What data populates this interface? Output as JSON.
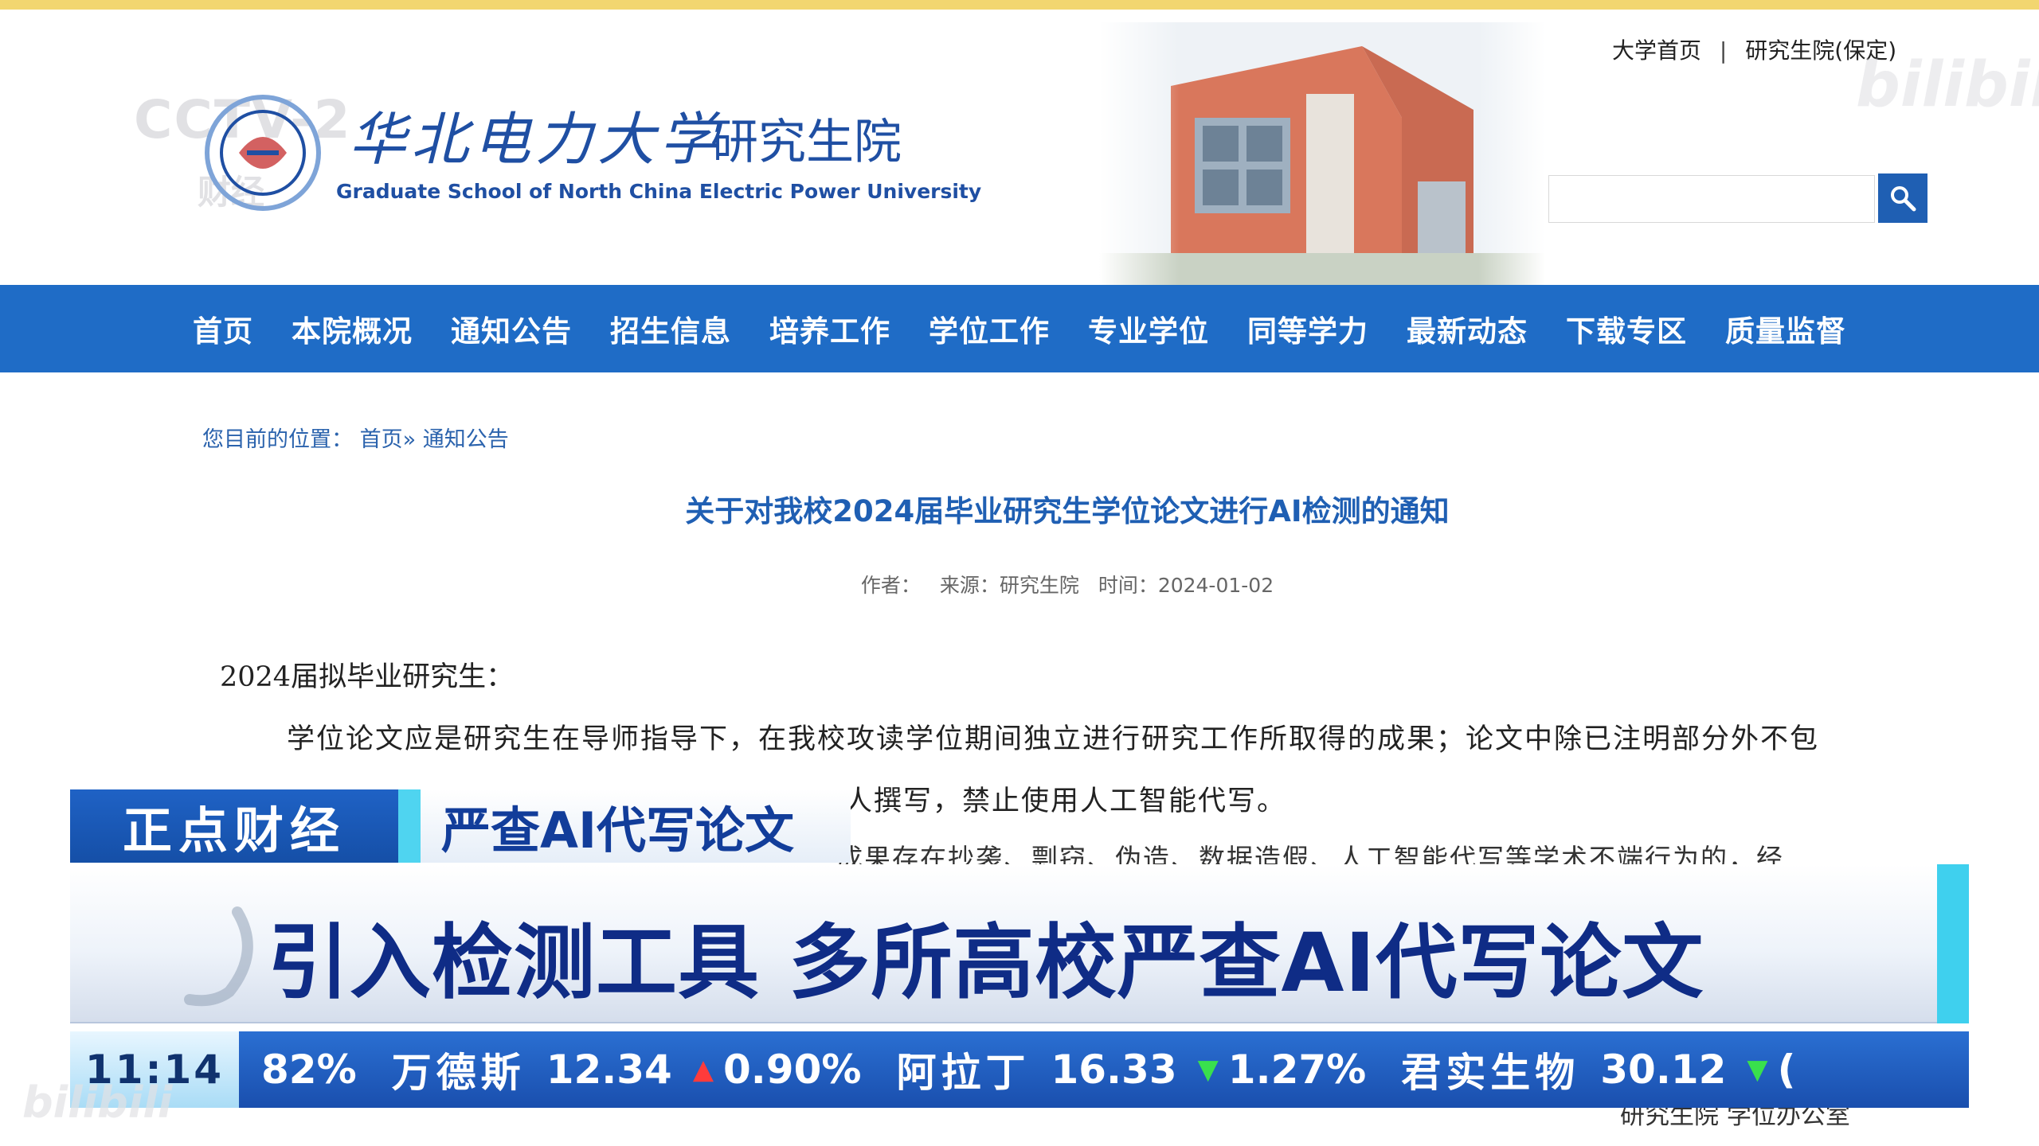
{
  "header": {
    "logo_cn": "华北电力大学",
    "logo_sub": "研究生院",
    "logo_en": "Graduate School of North China Electric  Power University",
    "top_link_1": "大学首页",
    "top_link_sep": "|",
    "top_link_2": "研究生院(保定)",
    "search_placeholder": "",
    "watermark_cctv": "CCTV-2",
    "watermark_cctv_sub": "财经",
    "watermark_bili": "bilibili"
  },
  "nav": {
    "items": [
      "首页",
      "本院概况",
      "通知公告",
      "招生信息",
      "培养工作",
      "学位工作",
      "专业学位",
      "同等学力",
      "最新动态",
      "下载专区",
      "质量监督"
    ]
  },
  "breadcrumb": {
    "prefix": "您目前的位置：",
    "home": "首页»",
    "current": "通知公告"
  },
  "article": {
    "title": "关于对我校2024届毕业研究生学位论文进行AI检测的通知",
    "meta_author": "作者：",
    "meta_source": "来源：研究生院",
    "meta_time": "时间：2024-01-02",
    "greeting": "2024届拟毕业研究生：",
    "p1": "学位论文应是研究生在导师指导下，在我校攻读学位期间独立进行研究工作所取得的成果；论文中除已注明部分外不包",
    "p2": "人撰写，禁止使用人工智能代写。",
    "p3": "成果存在抄袭、剽窃、伪造、数据造假、人工智能代写等学术不端行为的，经",
    "signature": "研究生院  学位办公室"
  },
  "overlay": {
    "program": "正点财经",
    "topic": "严查AI代写论文",
    "headline": "引入检测工具 多所高校严查AI代写论文",
    "time": "11:14",
    "ticker": [
      {
        "name": "",
        "value": "",
        "change": "82%",
        "dir": "none"
      },
      {
        "name": "万德斯",
        "value": "12.34",
        "change": "0.90%",
        "dir": "up"
      },
      {
        "name": "阿拉丁",
        "value": "16.33",
        "change": "1.27%",
        "dir": "down"
      },
      {
        "name": "君实生物",
        "value": "30.12",
        "change": "(",
        "dir": "down"
      }
    ],
    "watermark_bottom": "bilibili"
  },
  "colors": {
    "nav_bg": "#1f6cc6",
    "title_blue": "#1f5fb3",
    "headline_navy": "#0f2c86",
    "accent_cyan": "#3fd0ee",
    "ticker_up": "#ff3b3b",
    "ticker_down": "#39e04d"
  }
}
